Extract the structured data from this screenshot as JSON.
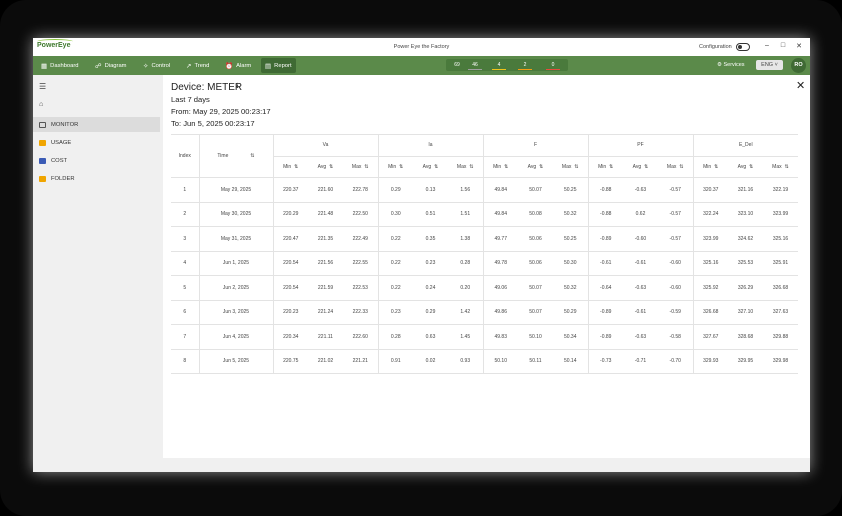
{
  "app": {
    "logo": "PowerEye",
    "window_title": "Power Eye the Factory",
    "configuration_label": "Configuration"
  },
  "nav": {
    "items": [
      {
        "label": "Dashboard",
        "icon": "dashboard-icon"
      },
      {
        "label": "Diagram",
        "icon": "diagram-icon"
      },
      {
        "label": "Control",
        "icon": "control-icon"
      },
      {
        "label": "Trend",
        "icon": "trend-icon"
      },
      {
        "label": "Alarm",
        "icon": "alarm-icon"
      },
      {
        "label": "Report",
        "icon": "report-icon"
      }
    ],
    "active": "Report",
    "stats": [
      "69",
      "46",
      "4",
      "2",
      "0"
    ],
    "stat_colors": [
      "#9e9e9e",
      "#9e9e9e",
      "#f0c419",
      "#f39c12",
      "#e74c3c"
    ],
    "services_label": "Services",
    "language": "ENG",
    "user_initials": "RO"
  },
  "sidebar": {
    "items": [
      {
        "label": "MONITOR",
        "color": "#555555"
      },
      {
        "label": "USAGE",
        "color": "#f0a500"
      },
      {
        "label": "COST",
        "color": "#3b5bb5"
      },
      {
        "label": "FOLDER",
        "color": "#f0a500"
      }
    ],
    "active": "MONITOR"
  },
  "report": {
    "title": "Device: METER",
    "range": "Last 7 days",
    "from": "From: May 29, 2025 00:23:17",
    "to": "To: Jun 5, 2025 00:23:17",
    "index_header": "Index",
    "time_header": "Time",
    "groups": [
      "Va",
      "Ia",
      "F",
      "PF",
      "E_Del"
    ],
    "sub_headers": [
      "Min",
      "Avg",
      "Max"
    ],
    "rows": [
      {
        "index": "1",
        "time": "May 29, 2025",
        "values": [
          "220.37",
          "221.60",
          "222.78",
          "0.29",
          "0.13",
          "1.56",
          "49.84",
          "50.07",
          "50.25",
          "-0.88",
          "-0.63",
          "-0.57",
          "320.37",
          "321.16",
          "322.19"
        ]
      },
      {
        "index": "2",
        "time": "May 30, 2025",
        "values": [
          "220.29",
          "221.48",
          "222.50",
          "0.30",
          "0.51",
          "1.51",
          "49.84",
          "50.08",
          "50.32",
          "-0.88",
          "0.62",
          "-0.57",
          "322.24",
          "323.10",
          "323.99"
        ]
      },
      {
        "index": "3",
        "time": "May 31, 2025",
        "values": [
          "220.47",
          "221.35",
          "222.49",
          "0.22",
          "0.35",
          "1.38",
          "49.77",
          "50.06",
          "50.25",
          "-0.89",
          "-0.60",
          "-0.57",
          "323.99",
          "324.62",
          "325.16"
        ]
      },
      {
        "index": "4",
        "time": "Jun 1, 2025",
        "values": [
          "220.54",
          "221.56",
          "222.55",
          "0.22",
          "0.23",
          "0.28",
          "49.78",
          "50.06",
          "50.30",
          "-0.61",
          "-0.61",
          "-0.60",
          "325.16",
          "325.53",
          "325.91"
        ]
      },
      {
        "index": "5",
        "time": "Jun 2, 2025",
        "values": [
          "220.54",
          "221.59",
          "222.53",
          "0.22",
          "0.24",
          "0.20",
          "49.06",
          "50.07",
          "50.32",
          "-0.64",
          "-0.63",
          "-0.60",
          "325.92",
          "326.29",
          "326.68"
        ]
      },
      {
        "index": "6",
        "time": "Jun 3, 2025",
        "values": [
          "220.23",
          "221.24",
          "222.33",
          "0.23",
          "0.29",
          "1.42",
          "49.86",
          "50.07",
          "50.29",
          "-0.89",
          "-0.61",
          "-0.59",
          "326.68",
          "327.10",
          "327.63"
        ]
      },
      {
        "index": "7",
        "time": "Jun 4, 2025",
        "values": [
          "220.34",
          "221.11",
          "222.60",
          "0.28",
          "0.63",
          "1.45",
          "49.83",
          "50.10",
          "50.34",
          "-0.89",
          "-0.63",
          "-0.58",
          "327.67",
          "328.68",
          "329.88"
        ]
      },
      {
        "index": "8",
        "time": "Jun 5, 2025",
        "values": [
          "220.75",
          "221.02",
          "221.21",
          "0.91",
          "0.02",
          "0.93",
          "50.10",
          "50.11",
          "50.14",
          "-0.73",
          "-0.71",
          "-0.70",
          "329.93",
          "329.95",
          "329.98"
        ]
      }
    ]
  },
  "colors": {
    "brand_green": "#5b8a4a",
    "active_green": "#3f6a34",
    "deco_green": "#3a9a2a",
    "deco_lime": "#9acd32"
  }
}
